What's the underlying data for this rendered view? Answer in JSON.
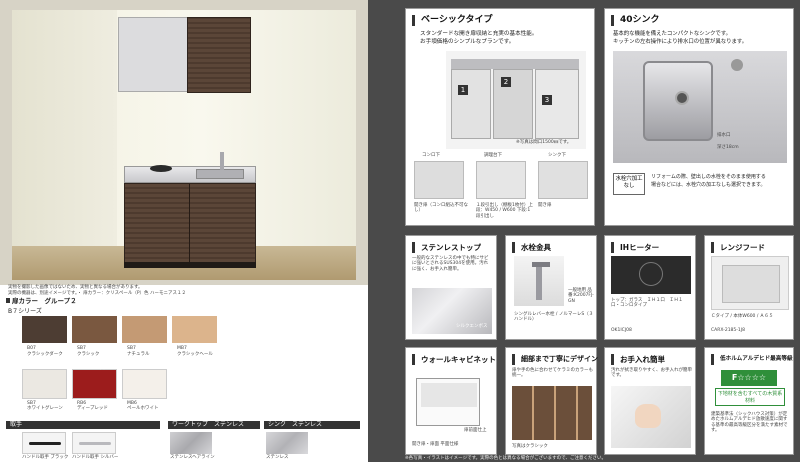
{
  "left": {
    "disclaimer_lines": [
      "実物を撮影した画像ではないため、実物と異なる場合があります。",
      "実際の機器は、別途イメージです。・ 扉カラー：クリスペール（P）色 ハーモニアス１２"
    ],
    "door_color_header": "扉カラー　グループ２",
    "series_b7": "B７シリーズ",
    "series_b6": "B６シリーズ",
    "b7_swatches": [
      {
        "code": "B07",
        "name": "クラシックダーク",
        "color": "#4d3d33"
      },
      {
        "code": "SB7",
        "name": "クラシック",
        "color": "#7a5840"
      },
      {
        "code": "SB7",
        "name": "ナチュラル",
        "color": "#c49a74"
      },
      {
        "code": "MB7",
        "name": "クラシックヘール",
        "color": "#dcb48c"
      }
    ],
    "b6_swatches": [
      {
        "code": "SB7",
        "name": "ホワイトグレーン",
        "color": "#ebe8e2"
      },
      {
        "code": "RB6",
        "name": "ディープレッド",
        "color": "#9c1c1c"
      },
      {
        "code": "MB6",
        "name": "ペールホワイト",
        "color": "#f4f0ea"
      }
    ],
    "handle_header": "取手",
    "handles": [
      {
        "name": "ハンドル取手 ブラック"
      },
      {
        "name": "ハンドル取手 シルバー"
      }
    ],
    "worktop_header": "ワークトップ　ステンレス",
    "worktop_item": "ステンレスヘアライン",
    "sink_header": "シンク　ステンレス",
    "sink_item": "ステンレス"
  },
  "basic": {
    "title": "ベーシックタイプ",
    "heading_line1": "スタンダードな開き扉収納と充実の基本性能。",
    "heading_line2": "お手頃価格のシンプルなプランです。",
    "photo_caption": "※写真は間口1500㎜です。",
    "markers": [
      "1",
      "2",
      "3"
    ],
    "sub_labels": [
      "コンロ下",
      "調理台下",
      "シンク下"
    ],
    "sub_captions": [
      "開き扉（コンロ組込不可なし）",
      "１段引出し（棚板1枚付）上段：W450 / W600 下段:1段引出し",
      "開き扉"
    ]
  },
  "sink40": {
    "title": "40シンク",
    "desc_line1": "基本的な機能を備えたコンパクトなシンクです。",
    "desc_line2": "キッチンの左右操作により排水口の位置が異なります。",
    "sink_labels": [
      "排水口",
      "深さ18cm"
    ],
    "badge": "水栓穴加工なし",
    "note_line1": "リフォームの際、壁出しの水栓をそのまま使用する",
    "note_line2": "場合などには、水栓穴の加工なしも選択できます。"
  },
  "cards": [
    {
      "title": "ステンレストップ",
      "body": "一般的なステンレスの中でも特にサビに強いとされるSUS304を使用。汚れに強く、お手入れ簡単。",
      "footer": "シルクエンボス"
    },
    {
      "title": "水栓金具",
      "body": "シングルレバー水栓 / ノルマーレS（３ハンドル）",
      "footer": "一般地用 品番:K2007FJ-GN"
    },
    {
      "title": "IHヒーター",
      "body": "トップ：ガラス　ＩＨ１口　ＩＨ１口・コンロタイプ",
      "footer": "OK1ICJ08"
    },
    {
      "title": "レンジフード",
      "body": "Ｃタイプ / 本体W600 / Ａ６５",
      "footer": "CARX-2185-1J8"
    },
    {
      "title": "ウォールキャビネット",
      "body": "開き扉・扉面 平面仕様",
      "footer": "扉前面仕上"
    },
    {
      "title": "細部まで丁寧にデザイン",
      "body": "扉や手の色に合わせてケラミのカラーも統一。",
      "footer": "写真はクラシック"
    },
    {
      "title": "お手入れ簡単",
      "body": "汚れが拭き取りやすく、お手入れが簡単です。",
      "footer": ""
    },
    {
      "title": "低ホルムアルデヒド最高等級",
      "body": "建築基準法（シックハウス対策）が定めたホルムアルデヒド放散速度に関する基準の最高等級区分を満たす素材です。",
      "footer": "F☆☆☆☆",
      "sub": "下地材を含むすべての木質系材料"
    }
  ],
  "footnote": "※各写真・イラストはイメージです。実際の色とは異なる場合がございますので、ご注意ください。"
}
